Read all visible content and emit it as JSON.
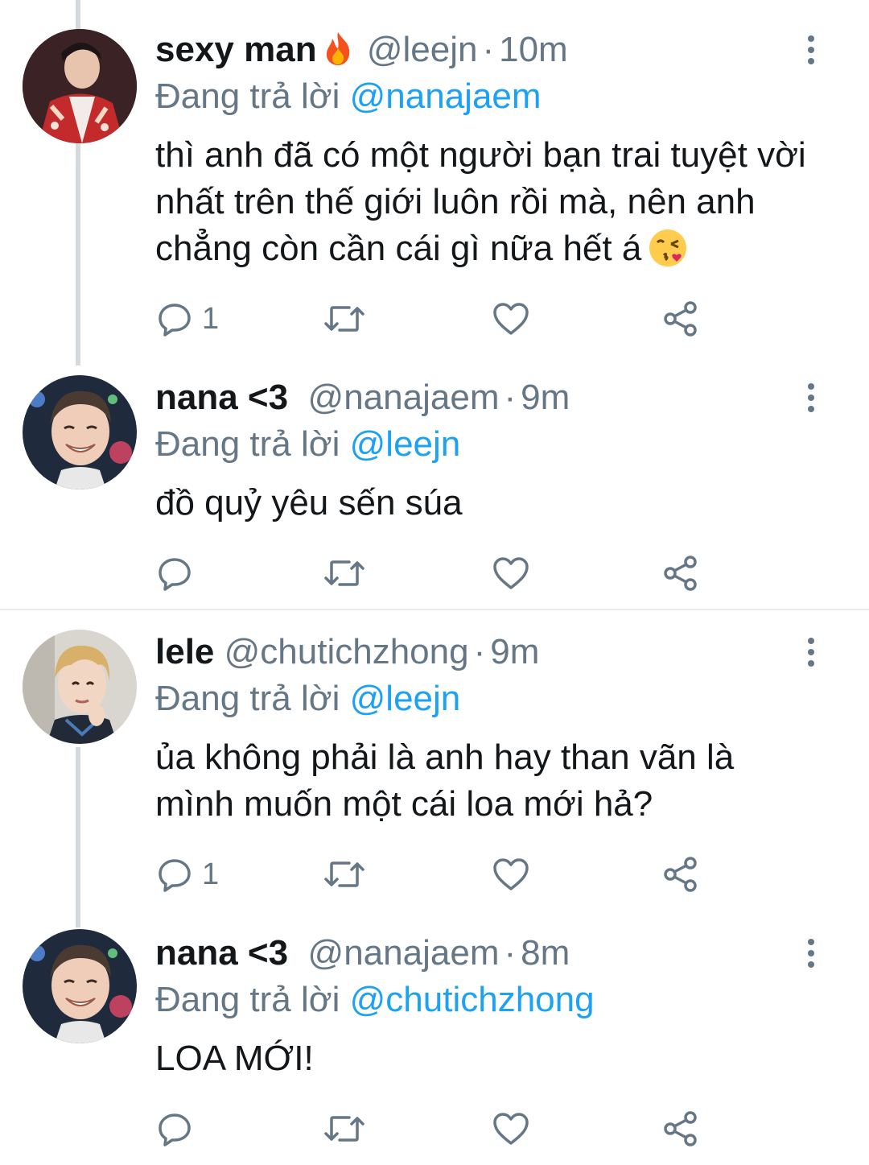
{
  "tweets": [
    {
      "name": "sexy man",
      "name_emoji": "fire",
      "handle": "@leejn",
      "time": "10m",
      "replying_label": "Đang trả lời",
      "replying_to": "@nanajaem",
      "text": "thì anh đã có một người bạn trai tuyệt vời nhất trên thế giới luôn rồi mà, nên anh chẳng còn cần cái gì nữa hết á",
      "text_emoji": "face-blowing-a-kiss",
      "reply_count": "1",
      "retweet_count": "",
      "like_count": ""
    },
    {
      "name": "nana <3",
      "handle": "@nanajaem",
      "time": "9m",
      "replying_label": "Đang trả lời",
      "replying_to": "@leejn",
      "text": "đồ quỷ yêu sến súa",
      "reply_count": "",
      "retweet_count": "",
      "like_count": ""
    },
    {
      "name": "lele",
      "handle": "@chutichzhong",
      "time": "9m",
      "replying_label": "Đang trả lời",
      "replying_to": "@leejn",
      "text": "ủa không phải là anh hay than vãn là mình muốn một cái loa mới hả?",
      "reply_count": "1",
      "retweet_count": "",
      "like_count": ""
    },
    {
      "name": "nana <3",
      "handle": "@nanajaem",
      "time": "8m",
      "replying_label": "Đang trả lời",
      "replying_to": "@chutichzhong",
      "text": "LOA MỚI!",
      "reply_count": "",
      "retweet_count": "",
      "like_count": ""
    }
  ],
  "icons": {
    "reply": "reply-icon",
    "retweet": "retweet-icon",
    "like": "like-icon",
    "share": "share-icon",
    "more": "more-vertical-icon"
  },
  "colors": {
    "name": "#14171a",
    "muted": "#657786",
    "mention": "#1da1f2",
    "thread_line": "#d5dade",
    "divider": "#e6ecf0"
  }
}
